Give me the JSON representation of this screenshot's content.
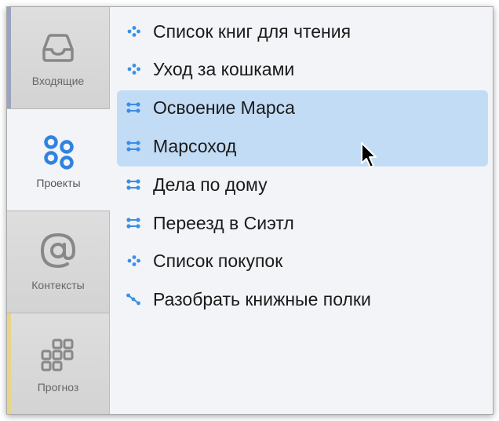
{
  "sidebar": {
    "items": [
      {
        "label": "Входящие",
        "icon": "inbox-icon",
        "stripe": "#9aa3c0"
      },
      {
        "label": "Проекты",
        "icon": "projects-icon",
        "active": true
      },
      {
        "label": "Контексты",
        "icon": "at-icon"
      },
      {
        "label": "Прогноз",
        "icon": "forecast-grid-icon",
        "stripe": "#e8d58a"
      }
    ]
  },
  "projects": [
    {
      "label": "Список книг для чтения",
      "icon": "single-action-list-icon"
    },
    {
      "label": "Уход за кошками",
      "icon": "single-action-list-icon"
    },
    {
      "label": "Освоение Марса",
      "icon": "parallel-project-icon",
      "selected": true
    },
    {
      "label": "Марсоход",
      "icon": "parallel-project-icon",
      "selected": true
    },
    {
      "label": "Дела по дому",
      "icon": "parallel-project-icon"
    },
    {
      "label": "Переезд в Сиэтл",
      "icon": "parallel-project-icon"
    },
    {
      "label": "Список покупок",
      "icon": "single-action-list-icon"
    },
    {
      "label": "Разобрать книжные полки",
      "icon": "sequential-project-icon"
    }
  ],
  "colors": {
    "accent": "#3a8ee6",
    "selection": "#c3dcf6"
  }
}
